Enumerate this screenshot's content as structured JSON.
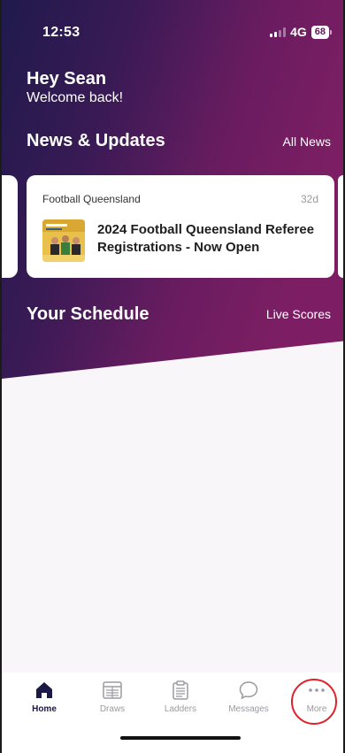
{
  "status_bar": {
    "time": "12:53",
    "network": "4G",
    "battery": "68"
  },
  "greeting": {
    "title": "Hey Sean",
    "subtitle": "Welcome back!"
  },
  "news": {
    "section_title": "News & Updates",
    "link_label": "All News",
    "cards": [
      {
        "source": "Football Queensland",
        "age": "32d",
        "headline": "2024 Football Queensland Referee Registrations - Now Open",
        "thumbnail_icon": "referee-news-thumbnail"
      }
    ]
  },
  "schedule": {
    "section_title": "Your Schedule",
    "link_label": "Live Scores"
  },
  "tab_bar": {
    "tabs": [
      {
        "label": "Home",
        "icon": "home-icon",
        "active": true
      },
      {
        "label": "Draws",
        "icon": "draws-icon",
        "active": false
      },
      {
        "label": "Ladders",
        "icon": "ladders-icon",
        "active": false
      },
      {
        "label": "Messages",
        "icon": "messages-icon",
        "active": false
      },
      {
        "label": "More",
        "icon": "more-icon",
        "active": false
      }
    ]
  },
  "colors": {
    "hero_dark": "#241a4f",
    "hero_accent": "#7b1e64",
    "active_tab": "#1d1947",
    "inactive_tab": "#9a9aa2",
    "highlight": "#e0202a"
  }
}
